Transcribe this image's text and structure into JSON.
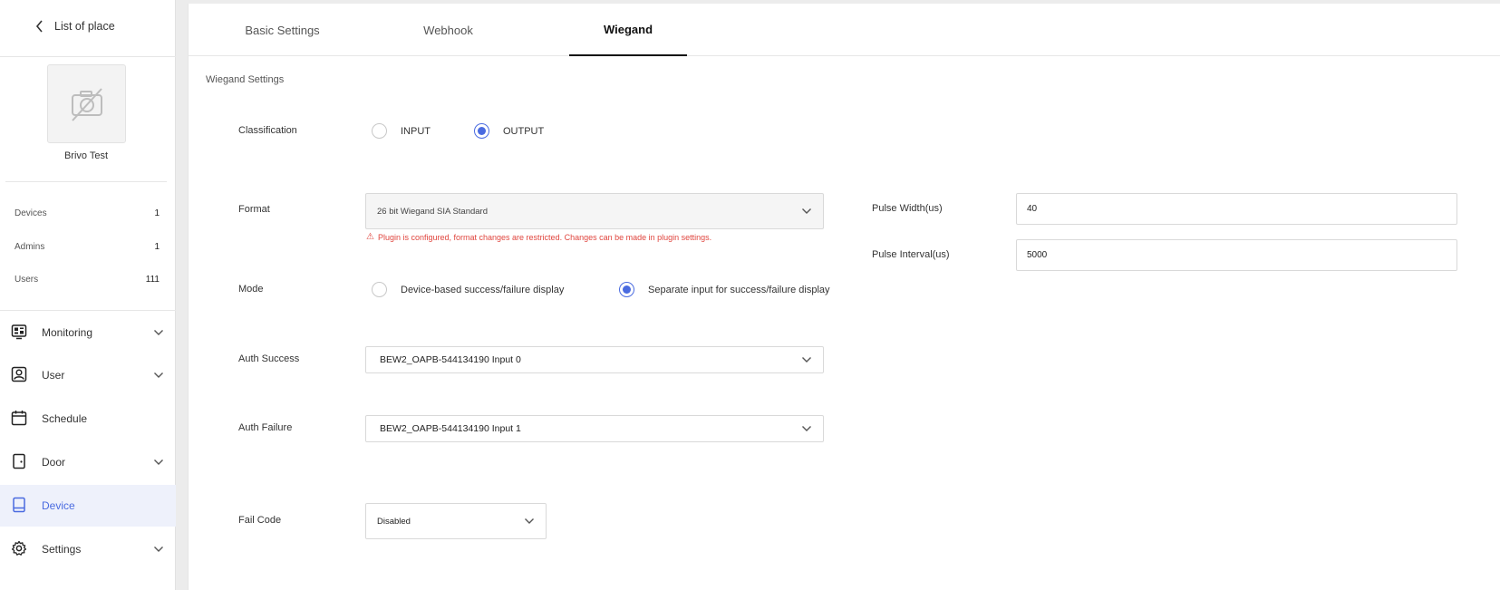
{
  "sidebar": {
    "back_label": "List of place",
    "place_name": "Brivo Test",
    "stats": [
      {
        "label": "Devices",
        "value": "1"
      },
      {
        "label": "Admins",
        "value": "1"
      },
      {
        "label": "Users",
        "value": "111"
      }
    ],
    "nav": [
      {
        "label": "Monitoring",
        "icon": "monitoring-icon",
        "expandable": true
      },
      {
        "label": "User",
        "icon": "user-icon",
        "expandable": true
      },
      {
        "label": "Schedule",
        "icon": "calendar-icon",
        "expandable": false
      },
      {
        "label": "Door",
        "icon": "door-icon",
        "expandable": true
      },
      {
        "label": "Device",
        "icon": "device-icon",
        "expandable": false,
        "active": true
      },
      {
        "label": "Settings",
        "icon": "gear-icon",
        "expandable": true
      }
    ]
  },
  "tabs": [
    {
      "label": "Basic Settings"
    },
    {
      "label": "Webhook"
    },
    {
      "label": "Wiegand",
      "active": true
    }
  ],
  "wiegand": {
    "section_title": "Wiegand Settings",
    "classification": {
      "label": "Classification",
      "options": [
        "INPUT",
        "OUTPUT"
      ],
      "selected": "OUTPUT"
    },
    "format": {
      "label": "Format",
      "value": "26 bit Wiegand SIA Standard",
      "warning": "Plugin is configured, format changes are restricted. Changes can be made in plugin settings."
    },
    "pulse_width": {
      "label": "Pulse Width(us)",
      "value": "40"
    },
    "pulse_interval": {
      "label": "Pulse Interval(us)",
      "value": "5000"
    },
    "mode": {
      "label": "Mode",
      "options": [
        "Device-based success/failure display",
        "Separate input for success/failure display"
      ],
      "selected": "Separate input for success/failure display"
    },
    "auth_success": {
      "label": "Auth Success",
      "value": "BEW2_OAPB-544134190 Input 0"
    },
    "auth_failure": {
      "label": "Auth Failure",
      "value": "BEW2_OAPB-544134190 Input 1"
    },
    "fail_code": {
      "label": "Fail Code",
      "value": "Disabled"
    }
  },
  "colors": {
    "accent": "#4a6be0",
    "warning": "#e0453e",
    "active_nav_bg": "#eef1fb"
  }
}
